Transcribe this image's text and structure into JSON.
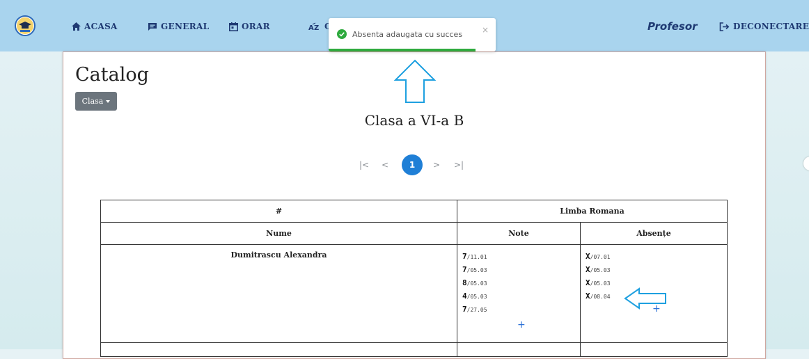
{
  "nav": {
    "items": [
      {
        "label": "ACASA",
        "icon": "home-icon"
      },
      {
        "label": "GENERAL",
        "icon": "chat-icon"
      },
      {
        "label": "ORAR",
        "icon": "calendar-icon"
      },
      {
        "label": "C",
        "icon": "sort-az-icon"
      }
    ],
    "profile": "Profesor",
    "logout": "DECONECTARE",
    "accent": "#1f3a73",
    "background": "#a9d4ee"
  },
  "toast": {
    "message": "Absenta adaugata cu succes",
    "close": "×",
    "icon": "check-circle-icon",
    "color": "#2eaa3e",
    "progress": 0.88
  },
  "page": {
    "title": "Catalog",
    "class_button": "Clasa",
    "class_heading": "Clasa a VI-a B"
  },
  "pagination": {
    "first": "|<",
    "prev": "<",
    "current": "1",
    "next": ">",
    "last": ">|"
  },
  "table": {
    "header_hash": "#",
    "subject": "Limba Romana",
    "col_name": "Nume",
    "col_grades": "Note",
    "col_absences": "Absențe",
    "add": "+",
    "rows": [
      {
        "name": "Dumitrascu Alexandra",
        "grades": [
          {
            "value": "7",
            "date": "/11.01"
          },
          {
            "value": "7",
            "date": "/05.03"
          },
          {
            "value": "8",
            "date": "/05.03"
          },
          {
            "value": "4",
            "date": "/05.03"
          },
          {
            "value": "7",
            "date": "/27.05"
          }
        ],
        "absences": [
          {
            "value": "X",
            "date": "/07.01"
          },
          {
            "value": "X",
            "date": "/05.03"
          },
          {
            "value": "X",
            "date": "/05.03"
          },
          {
            "value": "X",
            "date": "/08.04"
          }
        ]
      }
    ]
  },
  "annotation_color": "#1ea0e0"
}
